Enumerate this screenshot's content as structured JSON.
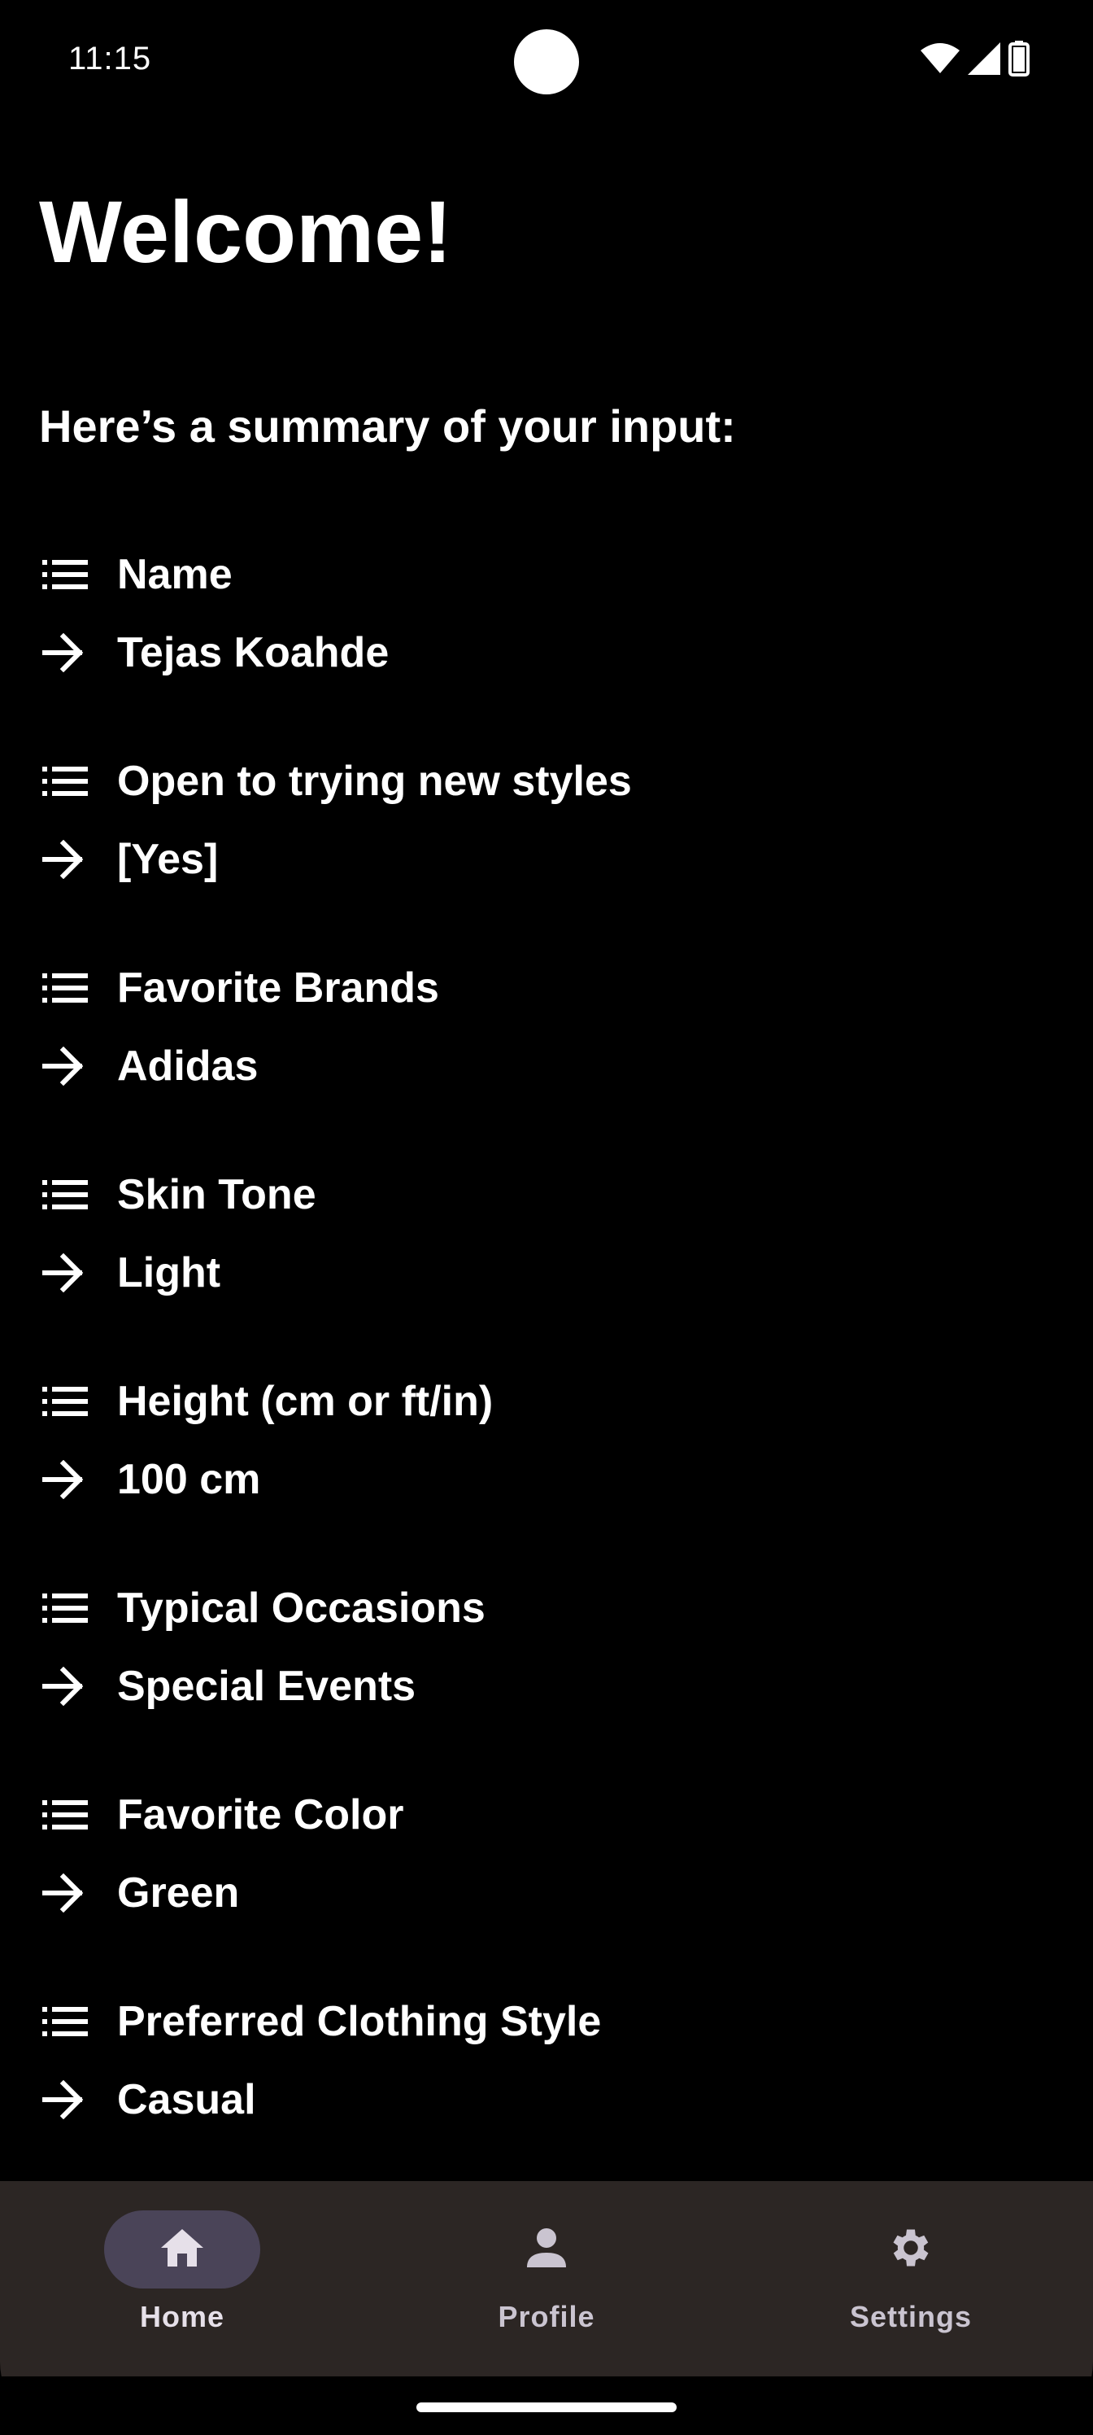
{
  "status_bar": {
    "time": "11:15",
    "icons": [
      "wifi-icon",
      "signal-icon",
      "battery-icon"
    ]
  },
  "page": {
    "title": "Welcome!",
    "subtitle": "Here’s a summary of your input:"
  },
  "summary": {
    "items": [
      {
        "label": "Name",
        "value": "Tejas Koahde"
      },
      {
        "label": "Open to trying new styles",
        "value": "[Yes]"
      },
      {
        "label": "Favorite Brands",
        "value": "Adidas"
      },
      {
        "label": "Skin Tone",
        "value": "Light"
      },
      {
        "label": "Height (cm or ft/in)",
        "value": "100 cm"
      },
      {
        "label": "Typical Occasions",
        "value": "Special Events"
      },
      {
        "label": "Favorite Color",
        "value": "Green"
      },
      {
        "label": "Preferred Clothing Style",
        "value": "Casual"
      }
    ]
  },
  "bottom_nav": {
    "items": [
      {
        "label": "Home",
        "icon": "home-icon",
        "active": true
      },
      {
        "label": "Profile",
        "icon": "person-icon",
        "active": false
      },
      {
        "label": "Settings",
        "icon": "gear-icon",
        "active": false
      }
    ]
  },
  "colors": {
    "background": "#000000",
    "nav_background": "#2c2624",
    "active_pill": "#4a4458",
    "nav_label": "#cac4d0",
    "text": "#ffffff"
  }
}
